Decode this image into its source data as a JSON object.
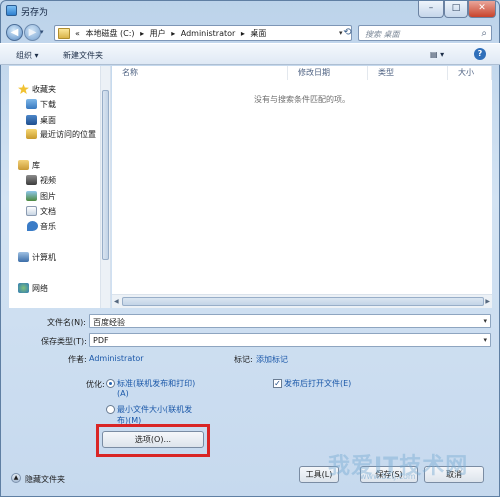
{
  "window": {
    "title": "另存为",
    "minimize": "–",
    "maximize": "□",
    "close": "✕"
  },
  "nav": {
    "back": "◀",
    "forward": "▶",
    "recent": "▾",
    "breadcrumb": [
      "«",
      "本地磁盘 (C:)",
      "▸",
      "用户",
      "▸",
      "Administrator",
      "▸",
      "桌面"
    ],
    "address_dropdown": "▾",
    "refresh": "⟲",
    "search_placeholder": "搜索 桌面"
  },
  "toolbar": {
    "organize": "组织 ▾",
    "new_folder": "新建文件夹",
    "view": "▤ ▾",
    "help": "?"
  },
  "sidebar": {
    "favorites": {
      "label": "收藏夹",
      "items": [
        "下载",
        "桌面",
        "最近访问的位置"
      ]
    },
    "libraries": {
      "label": "库",
      "items": [
        "视频",
        "图片",
        "文档",
        "音乐"
      ]
    },
    "computer": "计算机",
    "network": "网络"
  },
  "columns": [
    "名称",
    "修改日期",
    "类型",
    "大小"
  ],
  "empty_message": "没有与搜索条件匹配的项。",
  "form": {
    "filename_label": "文件名(N):",
    "filename_value": "百度经验",
    "filetype_label": "保存类型(T):",
    "filetype_value": "PDF",
    "author_label": "作者:",
    "author_value": "Administrator",
    "tags_label": "标记:",
    "tags_value": "添加标记",
    "optimize_label": "优化:",
    "option_standard": "标准(联机发布和打印)",
    "option_standard_key": "(A)",
    "option_min": "最小文件大小(联机发",
    "option_min_2": "布)(M)",
    "open_after_publish": "发布后打开文件(E)",
    "options_button": "选项(O)..."
  },
  "footer": {
    "hide_folders": "隐藏文件夹",
    "tools": "工具(L)",
    "save": "保存(S)",
    "cancel": "取消"
  },
  "watermark": {
    "text": "我爱IT技术网",
    "url": "www.52ij.com"
  }
}
